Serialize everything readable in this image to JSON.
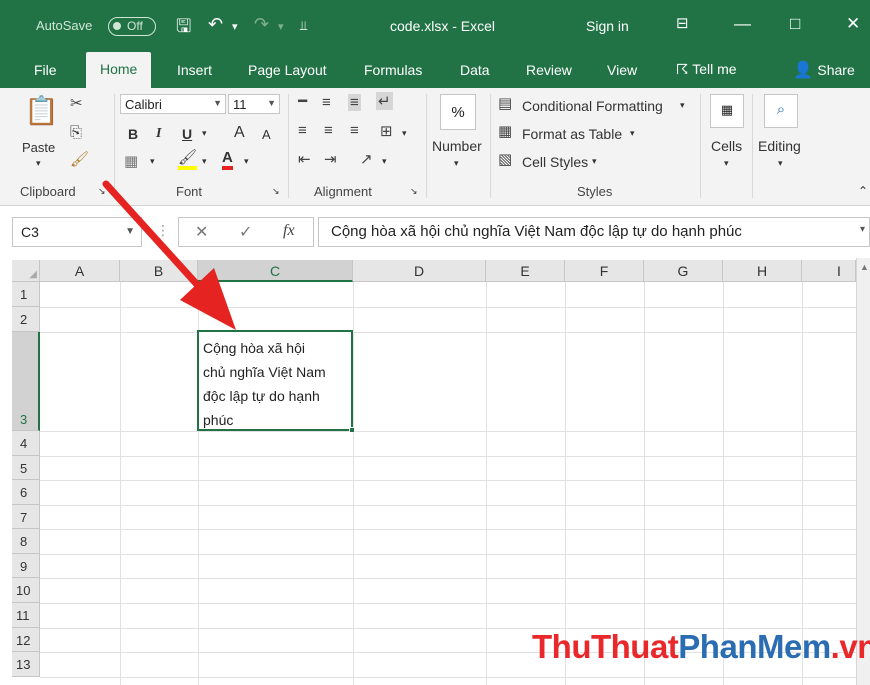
{
  "titlebar": {
    "autosave": "AutoSave",
    "toggle": "Off",
    "title": "code.xlsx  -  Excel",
    "signin": "Sign in"
  },
  "tabs": [
    {
      "label": "File"
    },
    {
      "label": "Home"
    },
    {
      "label": "Insert"
    },
    {
      "label": "Page Layout"
    },
    {
      "label": "Formulas"
    },
    {
      "label": "Data"
    },
    {
      "label": "Review"
    },
    {
      "label": "View"
    }
  ],
  "tellme": "Tell me",
  "share": "Share",
  "ribbon": {
    "clipboard": {
      "paste": "Paste",
      "label": "Clipboard"
    },
    "font": {
      "name": "Calibri",
      "size": "11",
      "bold": "B",
      "italic": "I",
      "underline": "U",
      "grow": "A",
      "shrink": "A",
      "label": "Font"
    },
    "alignment": {
      "label": "Alignment"
    },
    "number": {
      "symbol": "%",
      "label": "Number"
    },
    "styles": {
      "conditional": "Conditional Formatting",
      "table": "Format as Table",
      "cell_styles": "Cell Styles",
      "label": "Styles"
    },
    "cells": {
      "label": "Cells"
    },
    "editing": {
      "label": "Editing"
    }
  },
  "formula_bar": {
    "name_box": "C3",
    "fx": "fx",
    "formula": "Cộng hòa xã hội chủ nghĩa Việt Nam độc lập tự do hạnh phúc"
  },
  "sheet": {
    "columns": [
      "A",
      "B",
      "C",
      "D",
      "E",
      "F",
      "G",
      "H",
      "I"
    ],
    "rows": [
      "1",
      "2",
      "3",
      "4",
      "5",
      "6",
      "7",
      "8",
      "9",
      "10",
      "11",
      "12",
      "13"
    ],
    "active_cell_lines": [
      "Cộng hòa xã hội",
      "chủ nghĩa Việt Nam",
      "độc lập tự do hạnh",
      "phúc"
    ]
  },
  "watermark": {
    "part1": "ThuThuat",
    "part2": "PhanMem",
    "part3": ".vn"
  },
  "colors": {
    "excel_green": "#217346",
    "arrow_red": "#e52421"
  }
}
